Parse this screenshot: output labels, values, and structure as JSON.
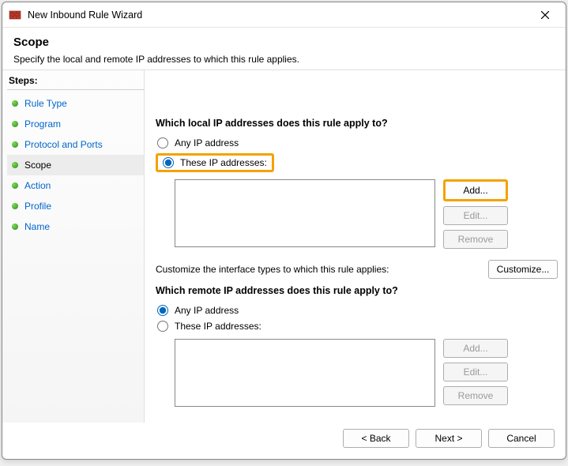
{
  "window": {
    "title": "New Inbound Rule Wizard"
  },
  "header": {
    "title": "Scope",
    "subtitle": "Specify the local and remote IP addresses to which this rule applies."
  },
  "sidebar": {
    "title": "Steps:",
    "items": [
      {
        "label": "Rule Type"
      },
      {
        "label": "Program"
      },
      {
        "label": "Protocol and Ports"
      },
      {
        "label": "Scope"
      },
      {
        "label": "Action"
      },
      {
        "label": "Profile"
      },
      {
        "label": "Name"
      }
    ],
    "active_index": 3
  },
  "content": {
    "local": {
      "heading": "Which local IP addresses does this rule apply to?",
      "option_any": "Any IP address",
      "option_these": "These IP addresses:",
      "selected": "these",
      "buttons": {
        "add": "Add...",
        "edit": "Edit...",
        "remove": "Remove"
      }
    },
    "customize": {
      "text": "Customize the interface types to which this rule applies:",
      "button": "Customize..."
    },
    "remote": {
      "heading": "Which remote IP addresses does this rule apply to?",
      "option_any": "Any IP address",
      "option_these": "These IP addresses:",
      "selected": "any",
      "buttons": {
        "add": "Add...",
        "edit": "Edit...",
        "remove": "Remove"
      }
    }
  },
  "footer": {
    "back": "< Back",
    "next": "Next >",
    "cancel": "Cancel"
  }
}
